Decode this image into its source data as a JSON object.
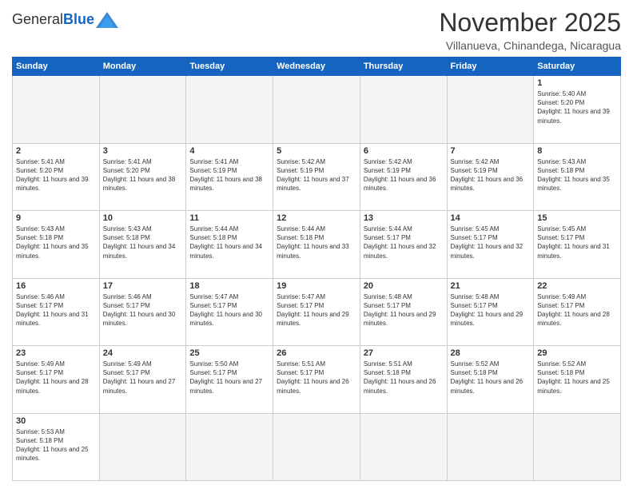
{
  "header": {
    "logo_general": "General",
    "logo_blue": "Blue",
    "month_title": "November 2025",
    "subtitle": "Villanueva, Chinandega, Nicaragua"
  },
  "weekdays": [
    "Sunday",
    "Monday",
    "Tuesday",
    "Wednesday",
    "Thursday",
    "Friday",
    "Saturday"
  ],
  "days": [
    {
      "date": 1,
      "sunrise": "5:40 AM",
      "sunset": "5:20 PM",
      "daylight": "11 hours and 39 minutes"
    },
    {
      "date": 2,
      "sunrise": "5:41 AM",
      "sunset": "5:20 PM",
      "daylight": "11 hours and 39 minutes"
    },
    {
      "date": 3,
      "sunrise": "5:41 AM",
      "sunset": "5:20 PM",
      "daylight": "11 hours and 38 minutes"
    },
    {
      "date": 4,
      "sunrise": "5:41 AM",
      "sunset": "5:19 PM",
      "daylight": "11 hours and 38 minutes"
    },
    {
      "date": 5,
      "sunrise": "5:42 AM",
      "sunset": "5:19 PM",
      "daylight": "11 hours and 37 minutes"
    },
    {
      "date": 6,
      "sunrise": "5:42 AM",
      "sunset": "5:19 PM",
      "daylight": "11 hours and 36 minutes"
    },
    {
      "date": 7,
      "sunrise": "5:42 AM",
      "sunset": "5:19 PM",
      "daylight": "11 hours and 36 minutes"
    },
    {
      "date": 8,
      "sunrise": "5:43 AM",
      "sunset": "5:18 PM",
      "daylight": "11 hours and 35 minutes"
    },
    {
      "date": 9,
      "sunrise": "5:43 AM",
      "sunset": "5:18 PM",
      "daylight": "11 hours and 35 minutes"
    },
    {
      "date": 10,
      "sunrise": "5:43 AM",
      "sunset": "5:18 PM",
      "daylight": "11 hours and 34 minutes"
    },
    {
      "date": 11,
      "sunrise": "5:44 AM",
      "sunset": "5:18 PM",
      "daylight": "11 hours and 34 minutes"
    },
    {
      "date": 12,
      "sunrise": "5:44 AM",
      "sunset": "5:18 PM",
      "daylight": "11 hours and 33 minutes"
    },
    {
      "date": 13,
      "sunrise": "5:44 AM",
      "sunset": "5:17 PM",
      "daylight": "11 hours and 32 minutes"
    },
    {
      "date": 14,
      "sunrise": "5:45 AM",
      "sunset": "5:17 PM",
      "daylight": "11 hours and 32 minutes"
    },
    {
      "date": 15,
      "sunrise": "5:45 AM",
      "sunset": "5:17 PM",
      "daylight": "11 hours and 31 minutes"
    },
    {
      "date": 16,
      "sunrise": "5:46 AM",
      "sunset": "5:17 PM",
      "daylight": "11 hours and 31 minutes"
    },
    {
      "date": 17,
      "sunrise": "5:46 AM",
      "sunset": "5:17 PM",
      "daylight": "11 hours and 30 minutes"
    },
    {
      "date": 18,
      "sunrise": "5:47 AM",
      "sunset": "5:17 PM",
      "daylight": "11 hours and 30 minutes"
    },
    {
      "date": 19,
      "sunrise": "5:47 AM",
      "sunset": "5:17 PM",
      "daylight": "11 hours and 29 minutes"
    },
    {
      "date": 20,
      "sunrise": "5:48 AM",
      "sunset": "5:17 PM",
      "daylight": "11 hours and 29 minutes"
    },
    {
      "date": 21,
      "sunrise": "5:48 AM",
      "sunset": "5:17 PM",
      "daylight": "11 hours and 29 minutes"
    },
    {
      "date": 22,
      "sunrise": "5:49 AM",
      "sunset": "5:17 PM",
      "daylight": "11 hours and 28 minutes"
    },
    {
      "date": 23,
      "sunrise": "5:49 AM",
      "sunset": "5:17 PM",
      "daylight": "11 hours and 28 minutes"
    },
    {
      "date": 24,
      "sunrise": "5:49 AM",
      "sunset": "5:17 PM",
      "daylight": "11 hours and 27 minutes"
    },
    {
      "date": 25,
      "sunrise": "5:50 AM",
      "sunset": "5:17 PM",
      "daylight": "11 hours and 27 minutes"
    },
    {
      "date": 26,
      "sunrise": "5:51 AM",
      "sunset": "5:17 PM",
      "daylight": "11 hours and 26 minutes"
    },
    {
      "date": 27,
      "sunrise": "5:51 AM",
      "sunset": "5:18 PM",
      "daylight": "11 hours and 26 minutes"
    },
    {
      "date": 28,
      "sunrise": "5:52 AM",
      "sunset": "5:18 PM",
      "daylight": "11 hours and 26 minutes"
    },
    {
      "date": 29,
      "sunrise": "5:52 AM",
      "sunset": "5:18 PM",
      "daylight": "11 hours and 25 minutes"
    },
    {
      "date": 30,
      "sunrise": "5:53 AM",
      "sunset": "5:18 PM",
      "daylight": "11 hours and 25 minutes"
    }
  ]
}
